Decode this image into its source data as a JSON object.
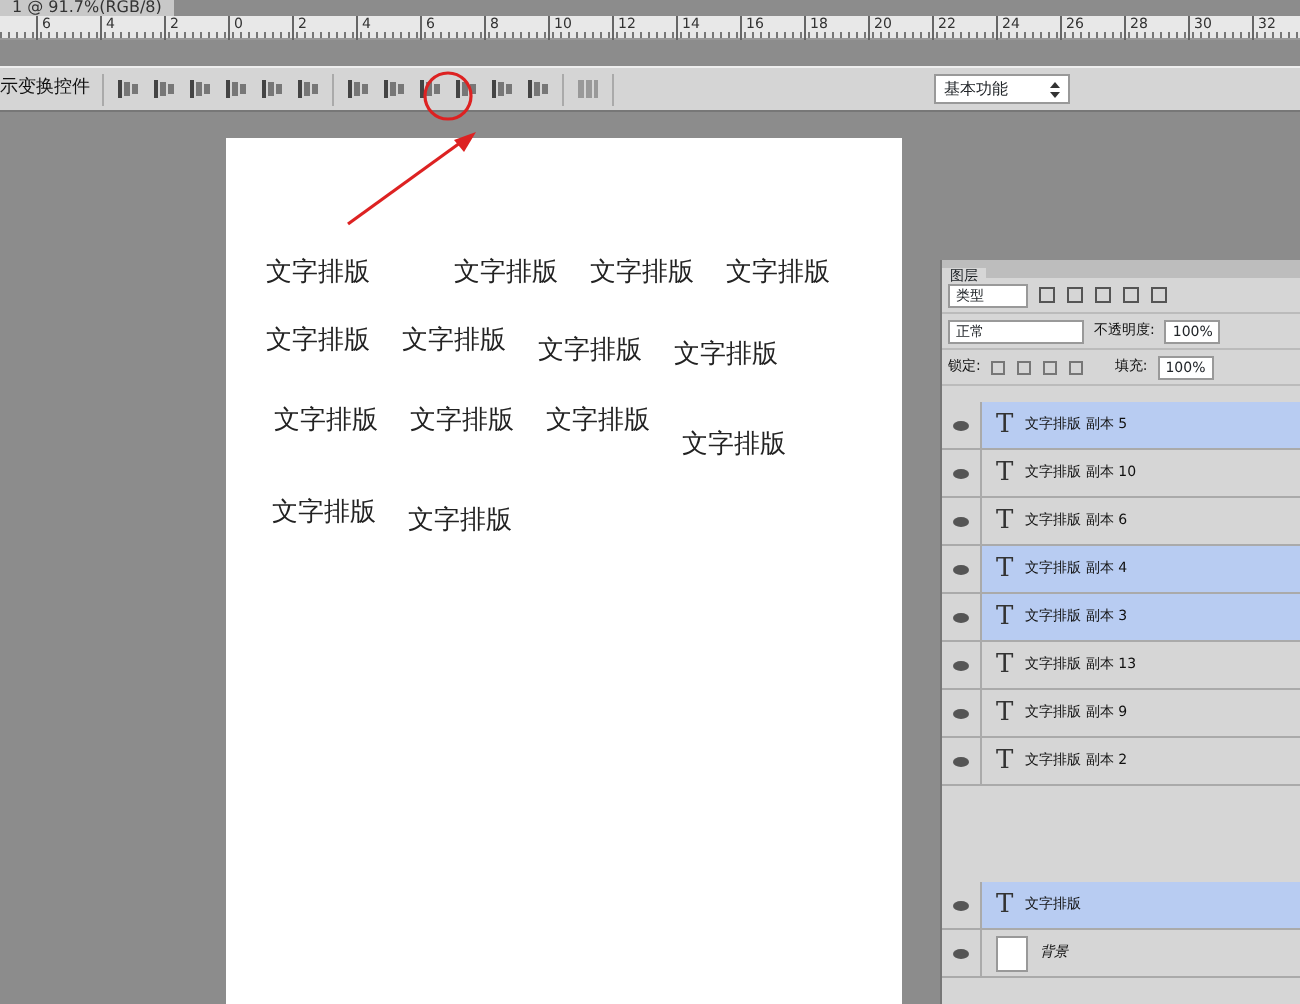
{
  "document_tab": {
    "title": "1 @ 91.7%(RGB/8)"
  },
  "ruler": {
    "ticks": [
      "6",
      "4",
      "2",
      "0",
      "2",
      "4",
      "6",
      "8",
      "10",
      "12",
      "14",
      "16",
      "18",
      "20",
      "22",
      "24",
      "26",
      "28",
      "30",
      "32"
    ]
  },
  "options_bar": {
    "label": "示变换控件",
    "workspace": "基本功能"
  },
  "canvas": {
    "rows": [
      [
        "文字排版",
        "文字排版",
        "文字排版",
        "文字排版"
      ],
      [
        "文字排版",
        "文字排版",
        "文字排版",
        "文字排版"
      ],
      [
        "文字排版",
        "文字排版",
        "文字排版",
        "文字排版"
      ],
      [
        "文字排版",
        "文字排版"
      ]
    ]
  },
  "layers_panel": {
    "tab": "图层",
    "filter": "类型",
    "blend_mode": "正常",
    "opacity_label": "不透明度:",
    "opacity": "100%",
    "lock_label": "锁定:",
    "fill_label": "填充:",
    "fill": "100%",
    "layers": [
      {
        "name": "文字排版 副本 5",
        "kind": "text",
        "icon": "T",
        "visible": true,
        "selected": true
      },
      {
        "name": "文字排版 副本 10",
        "kind": "text",
        "icon": "T",
        "visible": true,
        "selected": false
      },
      {
        "name": "文字排版 副本 6",
        "kind": "text",
        "icon": "T",
        "visible": true,
        "selected": false
      },
      {
        "name": "文字排版 副本 4",
        "kind": "text",
        "icon": "T",
        "visible": true,
        "selected": true
      },
      {
        "name": "文字排版 副本 3",
        "kind": "text",
        "icon": "T",
        "visible": true,
        "selected": true
      },
      {
        "name": "文字排版 副本 13",
        "kind": "text",
        "icon": "T",
        "visible": true,
        "selected": false
      },
      {
        "name": "文字排版 副本 9",
        "kind": "text",
        "icon": "T",
        "visible": true,
        "selected": false
      },
      {
        "name": "文字排版 副本 2",
        "kind": "text",
        "icon": "T",
        "visible": true,
        "selected": false
      },
      {
        "name": "文字排版",
        "kind": "text",
        "icon": "T",
        "visible": true,
        "selected": true
      },
      {
        "name": "背景",
        "kind": "image",
        "visible": true,
        "selected": false
      }
    ]
  }
}
